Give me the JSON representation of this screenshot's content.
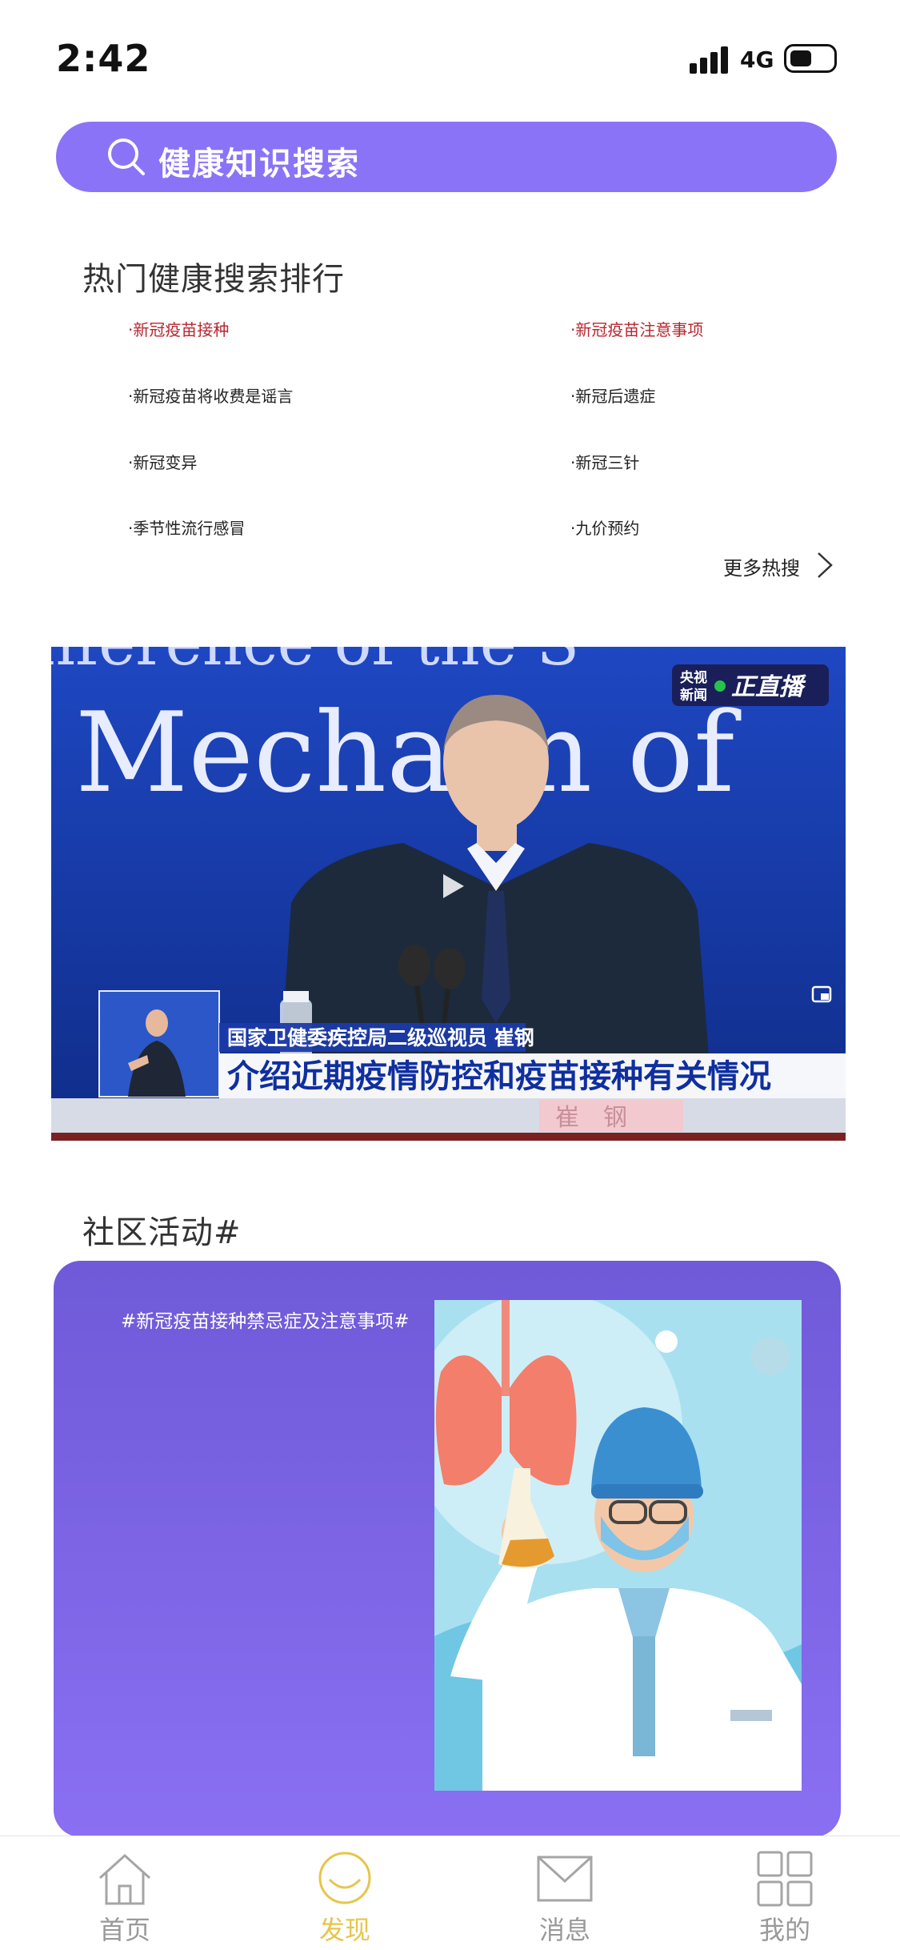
{
  "status": {
    "time": "2:42",
    "network": "4G"
  },
  "search": {
    "label": "健康知识搜索"
  },
  "hot": {
    "title": "热门健康搜索排行",
    "items": [
      {
        "label": "·新冠疫苗接种",
        "hot": true
      },
      {
        "label": "·新冠疫苗注意事项",
        "hot": true
      },
      {
        "label": "·新冠疫苗将收费是谣言",
        "hot": false
      },
      {
        "label": "·新冠后遗症",
        "hot": false
      },
      {
        "label": "·新冠变异",
        "hot": false
      },
      {
        "label": "·新冠三针",
        "hot": false
      },
      {
        "label": "·季节性流行感冒",
        "hot": false
      },
      {
        "label": "·九价预约",
        "hot": false
      }
    ],
    "more_label": "更多热搜"
  },
  "video": {
    "backdrop_top": "nference of the S",
    "backdrop_main": "Mecha    m  of",
    "badge_line1": "央视",
    "badge_line2": "新闻",
    "badge_live": "正直播",
    "caption_small": "国家卫健委疾控局二级巡视员 崔钢",
    "caption_big": "介绍近期疫情防控和疫苗接种有关情况",
    "nameplate": "崔　钢"
  },
  "community": {
    "title": "社区活动#",
    "tag": "#新冠疫苗接种禁忌症及注意事项#"
  },
  "tabs": [
    {
      "label": "首页",
      "icon": "home-icon",
      "active": false
    },
    {
      "label": "发现",
      "icon": "discover-icon",
      "active": true
    },
    {
      "label": "消息",
      "icon": "mail-icon",
      "active": false
    },
    {
      "label": "我的",
      "icon": "grid-icon",
      "active": false
    }
  ],
  "colors": {
    "accent": "#8b73f7",
    "hot": "#b8262e",
    "tab_active": "#e7c54a"
  }
}
